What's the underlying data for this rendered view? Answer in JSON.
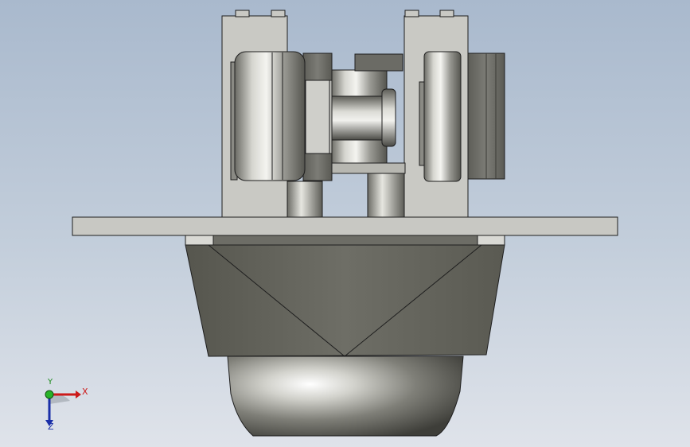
{
  "viewport": {
    "background_top": "#a9b9cd",
    "background_bottom": "#dfe3ea"
  },
  "model": {
    "body_color": "#c4c4bf",
    "housing_color": "#5f5f57",
    "bowl_color": "#d8d8d2",
    "edge_color": "#1e1e1e"
  },
  "triad": {
    "x_label": "X",
    "y_label": "Y",
    "z_label": "Z",
    "x_color": "#cc1a1a",
    "y_color": "#1c8a1c",
    "z_color": "#1a2fa8"
  }
}
